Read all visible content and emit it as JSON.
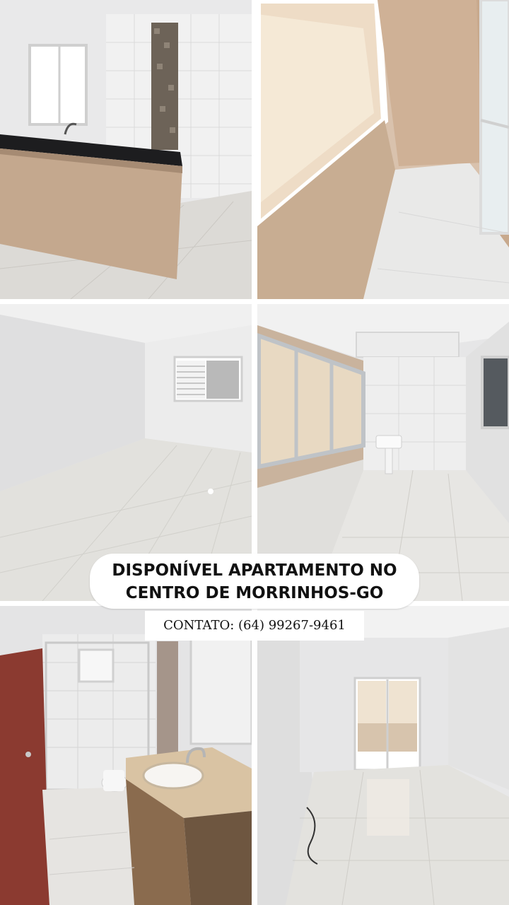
{
  "headline": {
    "line1": "DISPONÍVEL APARTAMENTO NO",
    "line2": "CENTRO DE MORRINHOS-GO"
  },
  "contact": {
    "text": "CONTATO: (64) 99267-9461"
  },
  "photos": [
    {
      "id": "kitchen-counter"
    },
    {
      "id": "hallway-window"
    },
    {
      "id": "empty-bedroom"
    },
    {
      "id": "laundry-room"
    },
    {
      "id": "bathroom"
    },
    {
      "id": "living-room"
    }
  ]
}
